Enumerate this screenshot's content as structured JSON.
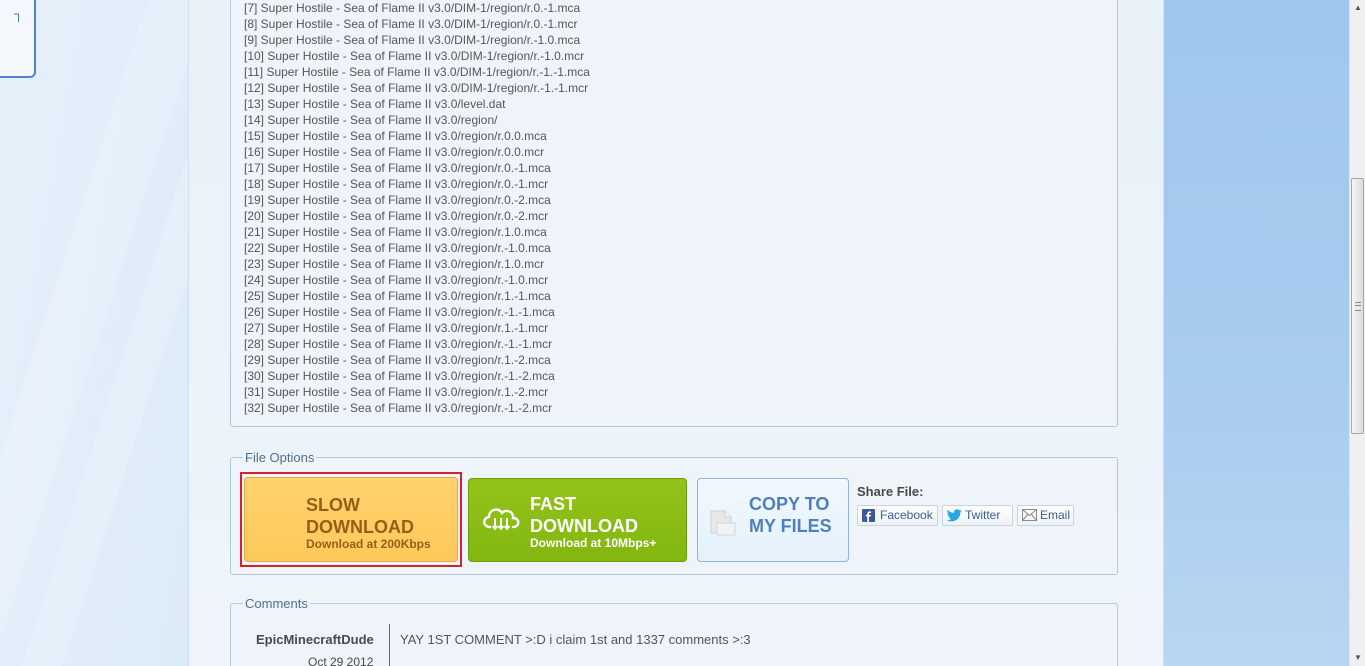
{
  "file_list": [
    "[7] Super Hostile - Sea of Flame II v3.0/DIM-1/region/r.0.-1.mca",
    "[8] Super Hostile - Sea of Flame II v3.0/DIM-1/region/r.0.-1.mcr",
    "[9] Super Hostile - Sea of Flame II v3.0/DIM-1/region/r.-1.0.mca",
    "[10] Super Hostile - Sea of Flame II v3.0/DIM-1/region/r.-1.0.mcr",
    "[11] Super Hostile - Sea of Flame II v3.0/DIM-1/region/r.-1.-1.mca",
    "[12] Super Hostile - Sea of Flame II v3.0/DIM-1/region/r.-1.-1.mcr",
    "[13] Super Hostile - Sea of Flame II v3.0/level.dat",
    "[14] Super Hostile - Sea of Flame II v3.0/region/",
    "[15] Super Hostile - Sea of Flame II v3.0/region/r.0.0.mca",
    "[16] Super Hostile - Sea of Flame II v3.0/region/r.0.0.mcr",
    "[17] Super Hostile - Sea of Flame II v3.0/region/r.0.-1.mca",
    "[18] Super Hostile - Sea of Flame II v3.0/region/r.0.-1.mcr",
    "[19] Super Hostile - Sea of Flame II v3.0/region/r.0.-2.mca",
    "[20] Super Hostile - Sea of Flame II v3.0/region/r.0.-2.mcr",
    "[21] Super Hostile - Sea of Flame II v3.0/region/r.1.0.mca",
    "[22] Super Hostile - Sea of Flame II v3.0/region/r.-1.0.mca",
    "[23] Super Hostile - Sea of Flame II v3.0/region/r.1.0.mcr",
    "[24] Super Hostile - Sea of Flame II v3.0/region/r.-1.0.mcr",
    "[25] Super Hostile - Sea of Flame II v3.0/region/r.1.-1.mca",
    "[26] Super Hostile - Sea of Flame II v3.0/region/r.-1.-1.mca",
    "[27] Super Hostile - Sea of Flame II v3.0/region/r.1.-1.mcr",
    "[28] Super Hostile - Sea of Flame II v3.0/region/r.-1.-1.mcr",
    "[29] Super Hostile - Sea of Flame II v3.0/region/r.1.-2.mca",
    "[30] Super Hostile - Sea of Flame II v3.0/region/r.-1.-2.mca",
    "[31] Super Hostile - Sea of Flame II v3.0/region/r.1.-2.mcr",
    "[32] Super Hostile - Sea of Flame II v3.0/region/r.-1.-2.mcr"
  ],
  "file_options": {
    "legend": "File Options",
    "slow": {
      "line1": "SLOW",
      "line2": "DOWNLOAD",
      "sub": "Download at 200Kbps",
      "icon": "none"
    },
    "fast": {
      "line1": "FAST",
      "line2": "DOWNLOAD",
      "sub": "Download at 10Mbps+",
      "icon": "cloud-download-icon"
    },
    "copy": {
      "line1": "COPY TO",
      "line2": "MY FILES",
      "icon": "document-icon"
    },
    "share": {
      "title": "Share File:",
      "buttons": [
        {
          "label": "Facebook",
          "icon": "facebook-icon"
        },
        {
          "label": "Twitter",
          "icon": "twitter-icon"
        },
        {
          "label": "Email",
          "icon": "envelope-icon"
        }
      ]
    }
  },
  "comments": {
    "legend": "Comments",
    "items": [
      {
        "author": "EpicMinecraftDude",
        "date": "Oct 29 2012",
        "text": "YAY 1ST COMMENT >:D i claim 1st and 1337 comments >:3"
      }
    ]
  },
  "left_tab": {
    "glyph": "┐"
  },
  "colors": {
    "slow_bg": "#fec95a",
    "fast_bg": "#82b710",
    "copy_text": "#4f80b9",
    "highlight": "#d5202e",
    "facebook": "#3b5998",
    "twitter": "#29a9e1"
  }
}
